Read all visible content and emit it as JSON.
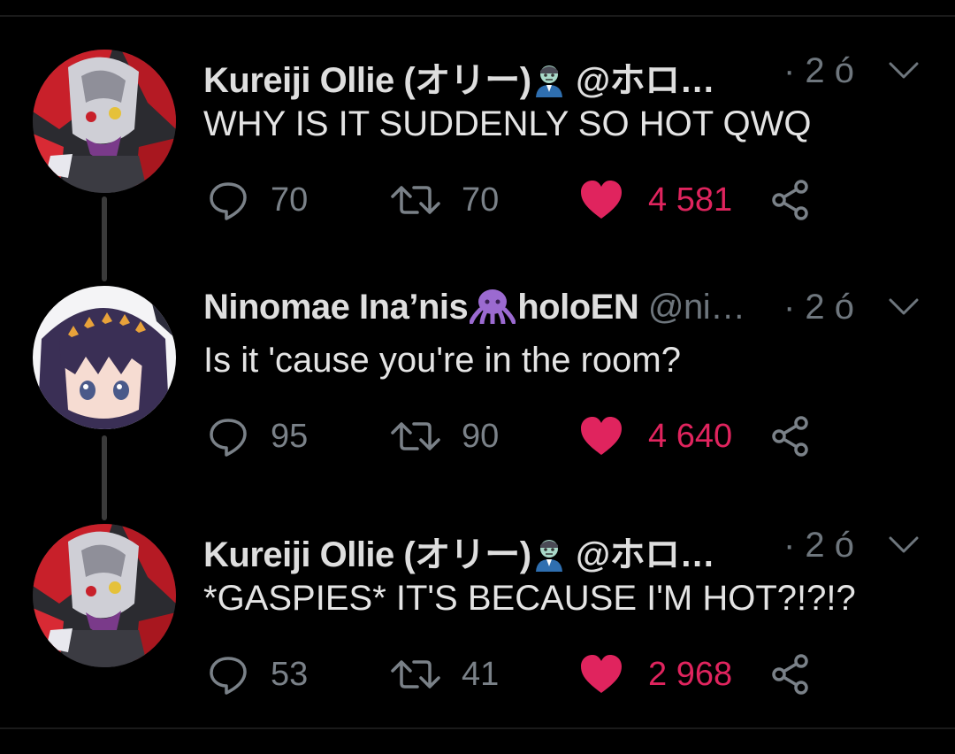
{
  "colors": {
    "background": "#000000",
    "text": "#e4e4e4",
    "muted": "#6e767d",
    "like": "#e0245e",
    "thread_line": "#3a3a3a"
  },
  "tweets": [
    {
      "display_name": "Kureiji Ollie (オリー)",
      "name_emoji": "zombie-emoji",
      "handle": "@ホロ…",
      "time": "· 2 ó",
      "text": "WHY IS IT SUDDENLY SO HOT QWQ",
      "replies": "70",
      "retweets": "70",
      "likes": "4 581",
      "liked": true,
      "avatar": "ollie-avatar"
    },
    {
      "display_name": "Ninomae Ina’nis",
      "name_emoji": "octopus-emoji",
      "name_suffix": "holoEN",
      "handle": "@ni…",
      "time": "· 2 ó",
      "text": "Is it 'cause you're in the room?",
      "replies": "95",
      "retweets": "90",
      "likes": "4 640",
      "liked": true,
      "avatar": "ina-avatar"
    },
    {
      "display_name": "Kureiji Ollie (オリー)",
      "name_emoji": "zombie-emoji",
      "handle": "@ホロ…",
      "time": "· 2 ó",
      "text": "*GASPIES* IT'S BECAUSE I'M HOT?!?!?",
      "replies": "53",
      "retweets": "41",
      "likes": "2 968",
      "liked": true,
      "avatar": "ollie-avatar"
    }
  ]
}
